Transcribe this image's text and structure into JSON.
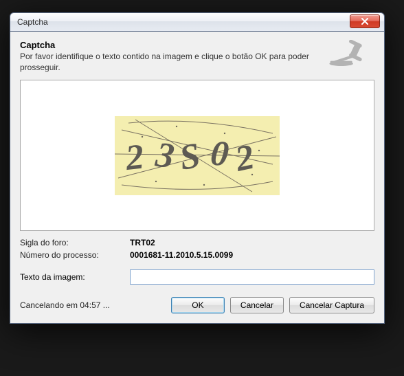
{
  "window": {
    "title": "Captcha"
  },
  "header": {
    "title": "Captcha",
    "description": "Por favor identifique o texto contido na imagem e clique o botão OK para poder prosseguir."
  },
  "captcha": {
    "rendered_text": "23S02"
  },
  "fields": {
    "sigla_label": "Sigla do foro:",
    "sigla_value": "TRT02",
    "numero_label": "Número do processo:",
    "numero_value": "0001681-11.2010.5.15.0099",
    "texto_label": "Texto da imagem:",
    "texto_value": ""
  },
  "footer": {
    "countdown": "Cancelando em 04:57 ...",
    "ok": "OK",
    "cancel": "Cancelar",
    "cancel_capture": "Cancelar Captura"
  }
}
